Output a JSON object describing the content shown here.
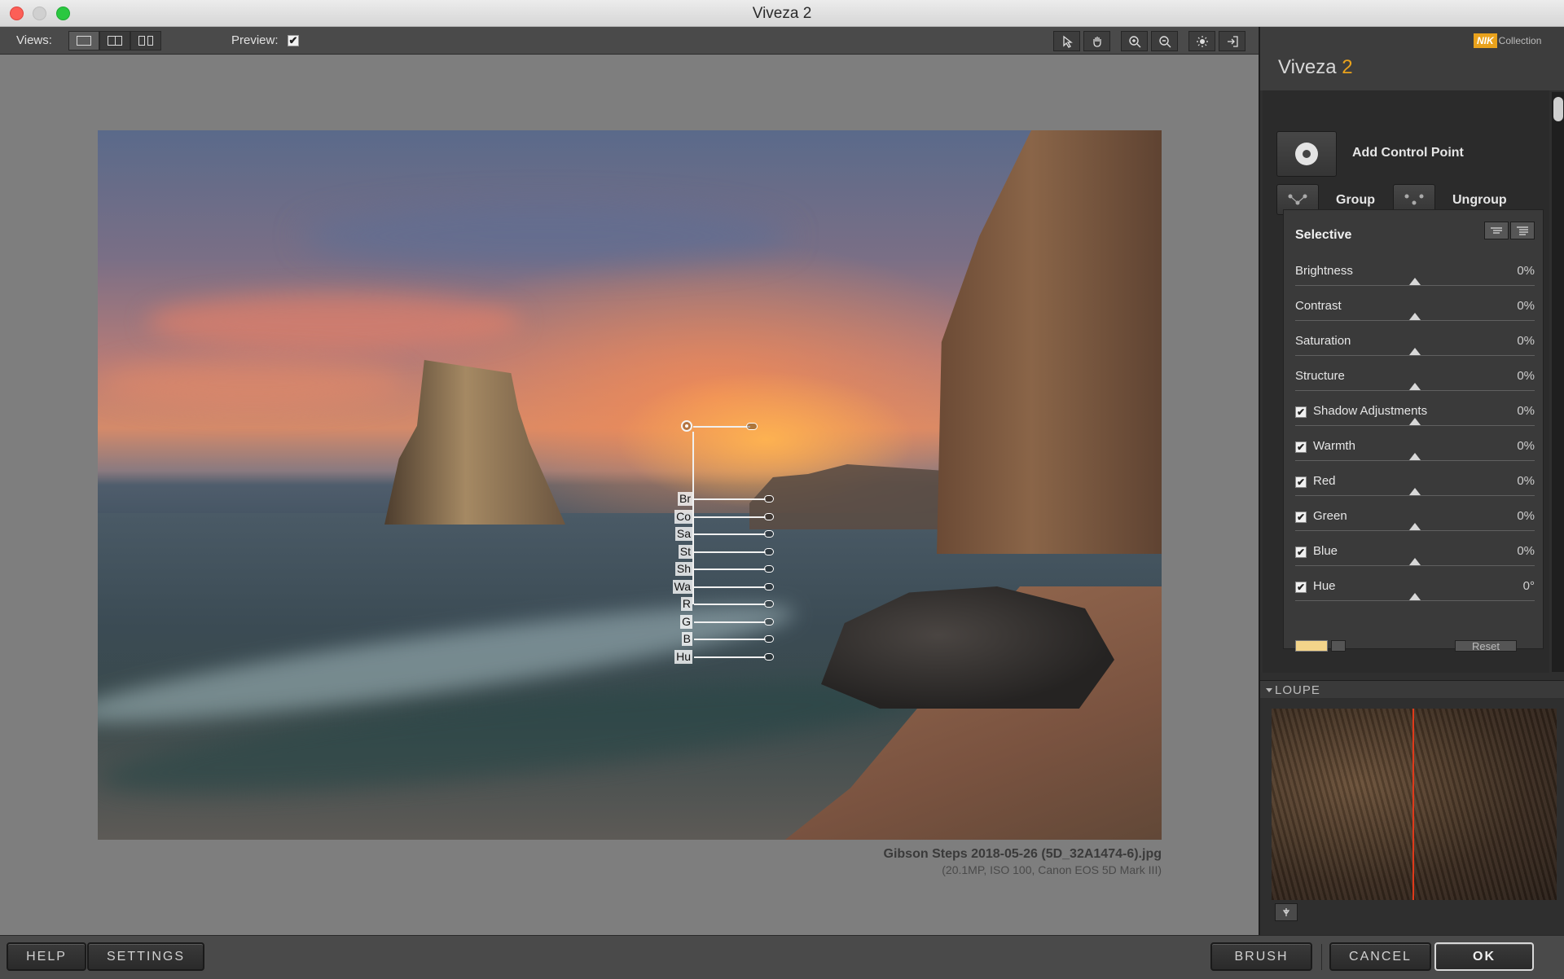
{
  "window": {
    "title": "Viveza 2"
  },
  "toolbar": {
    "views_label": "Views:",
    "preview_label": "Preview:",
    "preview_checked": "✔",
    "tools": [
      "arrow-icon",
      "hand-icon",
      "zoom-in-icon",
      "zoom-out-icon",
      "light-icon",
      "export-icon"
    ]
  },
  "image": {
    "filename": "Gibson Steps 2018-05-26 (5D_32A1474-6).jpg",
    "info": "(20.1MP, ISO 100, Canon EOS 5D Mark III)"
  },
  "control_point": {
    "labels": [
      "Br",
      "Co",
      "Sa",
      "St",
      "Sh",
      "Wa",
      "R",
      "G",
      "B",
      "Hu"
    ]
  },
  "panel": {
    "brand_mark": "NIK",
    "brand_text": "Collection",
    "title_main": "Viveza",
    "title_num": "2",
    "add_control_point": "Add Control Point",
    "group": "Group",
    "ungroup": "Ungroup",
    "selective_title": "Selective",
    "sliders": [
      {
        "label": "Brightness",
        "value": "0%",
        "checkbox": false
      },
      {
        "label": "Contrast",
        "value": "0%",
        "checkbox": false
      },
      {
        "label": "Saturation",
        "value": "0%",
        "checkbox": false
      },
      {
        "label": "Structure",
        "value": "0%",
        "checkbox": false
      },
      {
        "label": "Shadow Adjustments",
        "value": "0%",
        "checkbox": true
      },
      {
        "label": "Warmth",
        "value": "0%",
        "checkbox": true
      },
      {
        "label": "Red",
        "value": "0%",
        "checkbox": true
      },
      {
        "label": "Green",
        "value": "0%",
        "checkbox": true
      },
      {
        "label": "Blue",
        "value": "0%",
        "checkbox": true
      },
      {
        "label": "Hue",
        "value": "0°",
        "checkbox": true
      }
    ],
    "reset_label": "Reset",
    "loupe_label": "LOUPE"
  },
  "bottom": {
    "help": "HELP",
    "settings": "SETTINGS",
    "brush": "BRUSH",
    "cancel": "CANCEL",
    "ok": "OK"
  },
  "colors": {
    "accent": "#e9a21c",
    "loupe_line": "#e03a1a"
  }
}
